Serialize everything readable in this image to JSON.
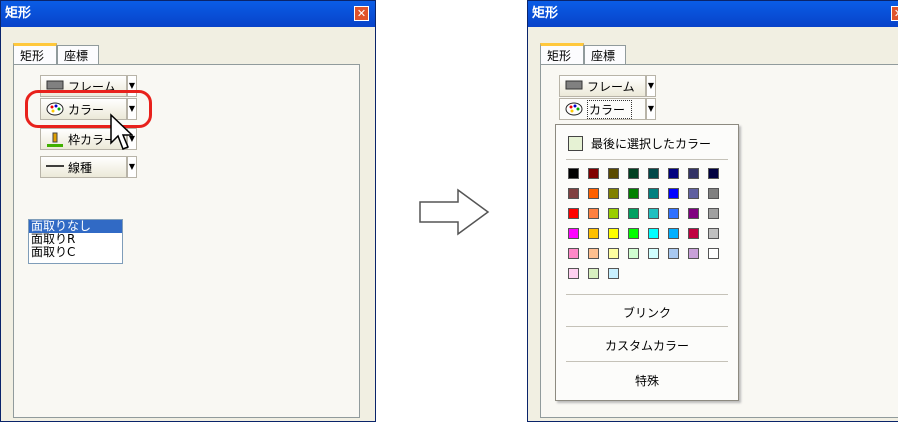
{
  "left_window": {
    "title": "矩形",
    "close_symbol": "✕",
    "tabs": [
      {
        "label": "矩形"
      },
      {
        "label": "座標"
      }
    ],
    "buttons": {
      "frame": "フレーム",
      "color": "カラー",
      "border_color": "枠カラー",
      "line_type": "線種"
    },
    "list": [
      "面取りなし",
      "面取りR",
      "面取りC"
    ],
    "selected_index": 0
  },
  "right_window": {
    "title": "矩形",
    "close_symbol": "✕",
    "tabs": [
      {
        "label": "矩形"
      },
      {
        "label": "座標"
      }
    ],
    "buttons": {
      "frame": "フレーム",
      "color": "カラー"
    },
    "color_menu": {
      "last_selected_label": "最後に選択したカラー",
      "last_selected_color": "#e6f2d4",
      "palette": [
        [
          "#000000",
          "#800000",
          "#5a4a00",
          "#004020",
          "#004848",
          "#000080",
          "#333366",
          "#000040"
        ],
        [
          "#804040",
          "#ff6000",
          "#808000",
          "#008000",
          "#008080",
          "#0000ff",
          "#6060a0",
          "#808080"
        ],
        [
          "#ff0000",
          "#ff8040",
          "#9acd00",
          "#00a060",
          "#20c0c0",
          "#3070ff",
          "#800080",
          "#a0a0a0"
        ],
        [
          "#ff00ff",
          "#ffc000",
          "#ffff00",
          "#00ff00",
          "#00ffff",
          "#00b0ff",
          "#c00040",
          "#c0c0c0"
        ],
        [
          "#ff88c8",
          "#ffc090",
          "#ffffa0",
          "#d0ffd0",
          "#d0ffff",
          "#a8c8f0",
          "#c8a0d8",
          "#ffffff"
        ],
        [
          "#ffd0f0",
          "#d8f0c0",
          "#c8f0ff"
        ]
      ],
      "items": [
        "ブリンク",
        "カスタムカラー",
        "特殊"
      ]
    }
  },
  "colors": {
    "title_bar": "#0a5de6",
    "highlight": "#e8211b",
    "list_selection": "#316ac5"
  }
}
